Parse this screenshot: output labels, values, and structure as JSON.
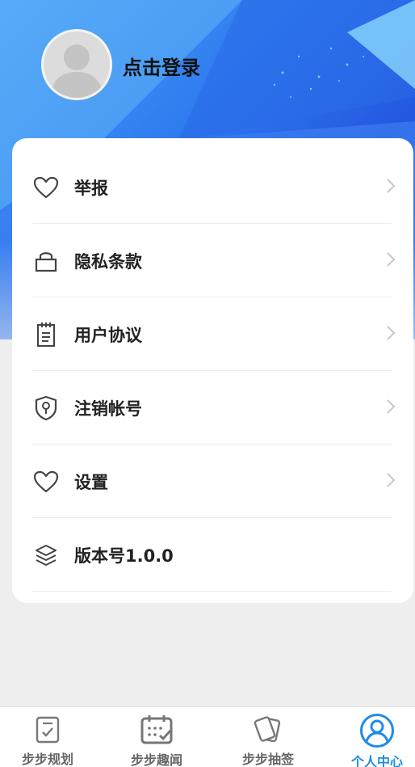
{
  "profile": {
    "login_label": "点击登录"
  },
  "menu": {
    "items": [
      {
        "label": "举报",
        "icon": "heart-icon"
      },
      {
        "label": "隐私条款",
        "icon": "lock-icon"
      },
      {
        "label": "用户协议",
        "icon": "clipboard-icon"
      },
      {
        "label": "注销帐号",
        "icon": "shield-key-icon"
      },
      {
        "label": "设置",
        "icon": "heart-icon"
      },
      {
        "label": "版本号1.0.0",
        "icon": "layers-icon"
      }
    ]
  },
  "tabbar": {
    "tabs": [
      {
        "label": "步步规划",
        "icon": "checklist-icon"
      },
      {
        "label": "步步趣闻",
        "icon": "calendar-check-icon"
      },
      {
        "label": "步步抽签",
        "icon": "cards-icon"
      },
      {
        "label": "个人中心",
        "icon": "user-circle-icon"
      }
    ],
    "active_index": 3
  },
  "colors": {
    "accent": "#1f8ce6",
    "hero_blue": "#2f7cf0",
    "background": "#eeeeee"
  }
}
